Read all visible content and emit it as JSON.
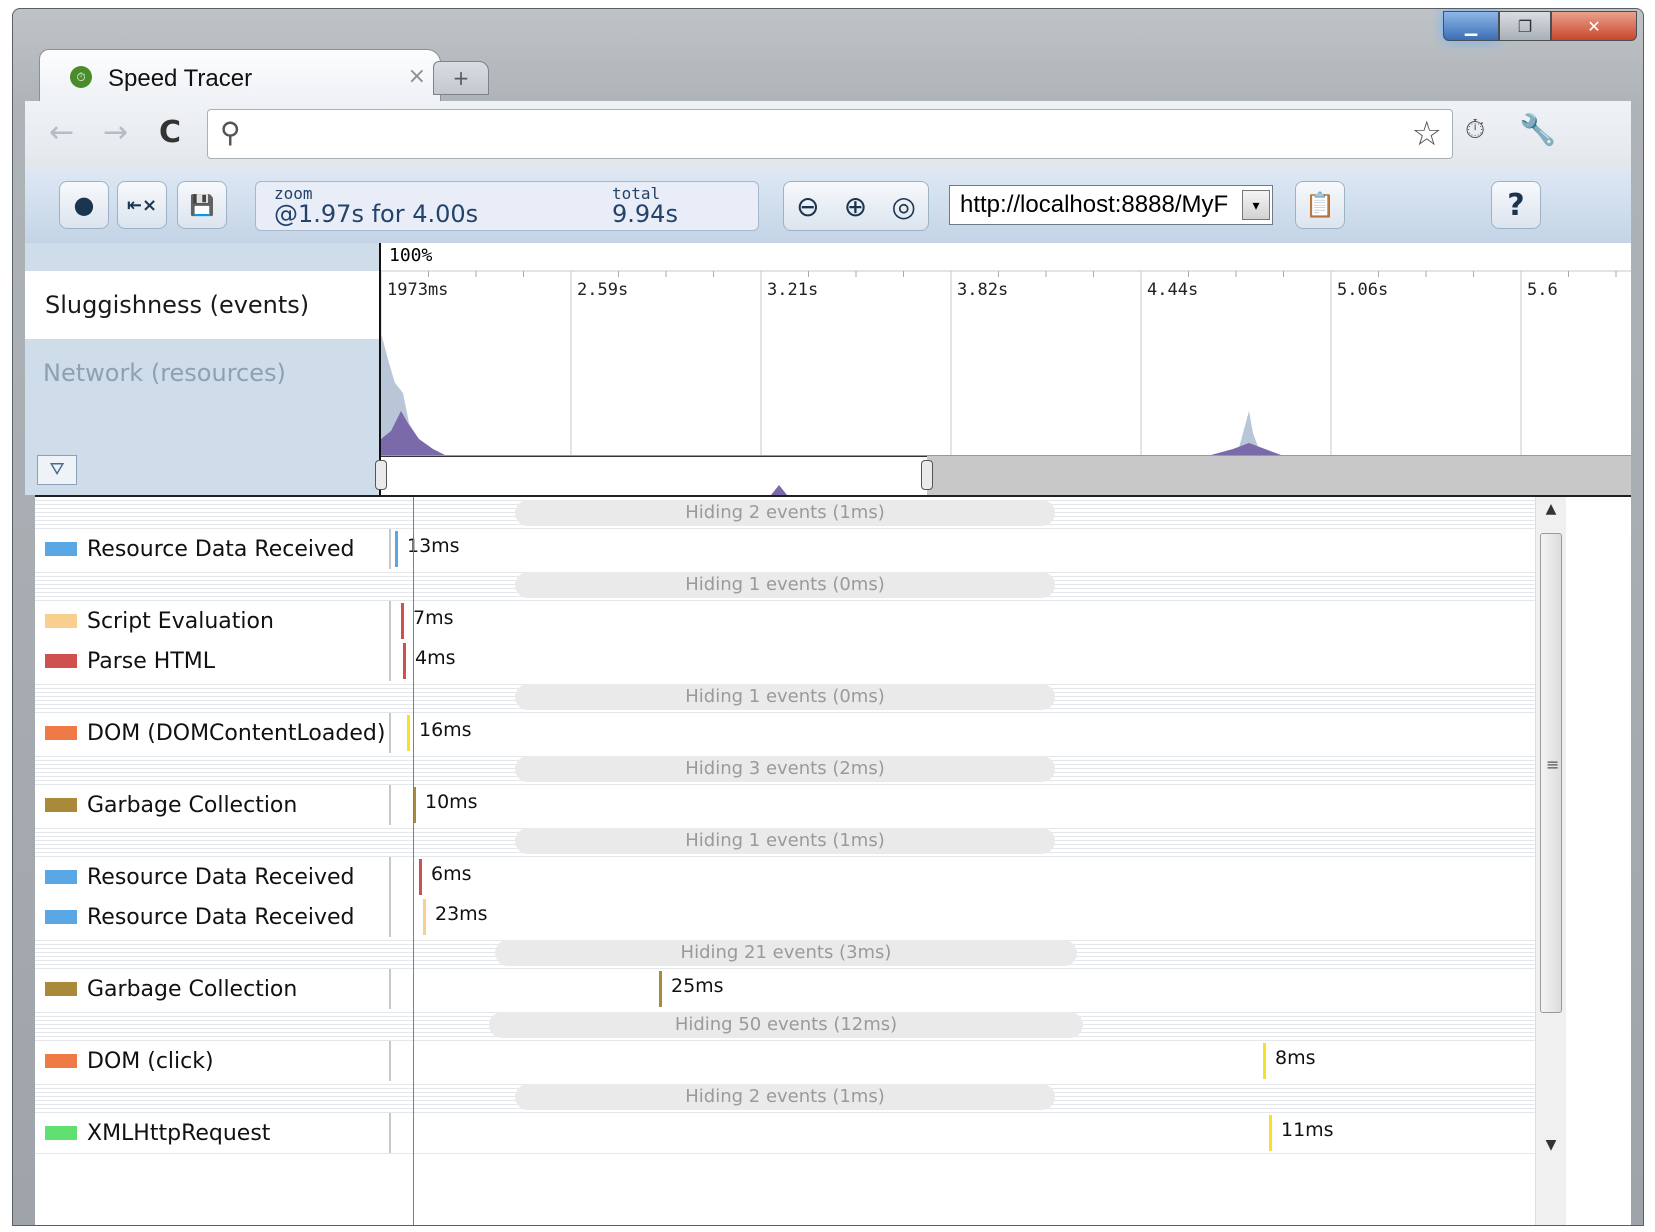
{
  "window": {
    "tab_title": "Speed Tracer",
    "tab_close": "×",
    "new_tab": "+",
    "min": "▁",
    "max": "❐",
    "close": "✕"
  },
  "toolbar": {
    "back_icon": "←",
    "forward_icon": "→",
    "reload_icon": "C",
    "search_icon": "⚲",
    "address_value": "",
    "star_icon": "☆",
    "extension_icon": "⏱",
    "wrench_icon": "🔧"
  },
  "speedtracer": {
    "record_icon": "●",
    "clear_icon": "⇤×",
    "save_icon": "💾",
    "zoom_label": "zoom",
    "zoom_value": "@1.97s for 4.00s",
    "total_label": "total",
    "total_value": "9.94s",
    "zoom_out_icon": "⊖",
    "zoom_in_icon": "⊕",
    "zoom_fit_icon": "◎",
    "url_selected": "http://localhost:8888/MyF",
    "dropdown_icon": "▾",
    "report_icon": "📋",
    "help_label": "?"
  },
  "overview": {
    "tracks": [
      {
        "label": "Sluggishness (events)"
      },
      {
        "label": "Network (resources)"
      }
    ],
    "filter_icon": "⛛",
    "percent_label": "100%",
    "ticks": [
      "1973ms",
      "2.59s",
      "3.21s",
      "3.82s",
      "4.44s",
      "5.06s",
      "5.6"
    ],
    "colors": {
      "graph_fill": "#7a6aaa",
      "graph_light": "#b9c6d8"
    }
  },
  "events": [
    {
      "kind": "hiding",
      "text": "Hiding 2 events (1ms)"
    },
    {
      "kind": "row",
      "label": "Resource Data Received",
      "swatch": "#5aa7e6",
      "mark": "#5aa7e6",
      "dur": "13ms"
    },
    {
      "kind": "hiding",
      "text": "Hiding 1 events (0ms)"
    },
    {
      "kind": "row",
      "label": "Script Evaluation",
      "swatch": "#f9cf90",
      "mark": "#d05050",
      "dur": "7ms"
    },
    {
      "kind": "row",
      "label": "Parse HTML",
      "swatch": "#d05050",
      "mark": "#d05050",
      "dur": "4ms"
    },
    {
      "kind": "hiding",
      "text": "Hiding 1 events (0ms)"
    },
    {
      "kind": "row",
      "label": "DOM (DOMContentLoaded)",
      "swatch": "#f07a46",
      "mark": "#f5e12a",
      "dur": "16ms"
    },
    {
      "kind": "hiding",
      "text": "Hiding 3 events (2ms)"
    },
    {
      "kind": "row",
      "label": "Garbage Collection",
      "swatch": "#a88a3a",
      "mark": "#a88a3a",
      "dur": "10ms"
    },
    {
      "kind": "hiding",
      "text": "Hiding 1 events (1ms)"
    },
    {
      "kind": "row",
      "label": "Resource Data Received",
      "swatch": "#5aa7e6",
      "mark": "#d05050",
      "dur": "6ms"
    },
    {
      "kind": "row",
      "label": "Resource Data Received",
      "swatch": "#5aa7e6",
      "mark": "#f9cf90",
      "dur": "23ms"
    },
    {
      "kind": "hiding",
      "text": "Hiding 21 events (3ms)"
    },
    {
      "kind": "row",
      "label": "Garbage Collection",
      "swatch": "#a88a3a",
      "mark": "#a88a3a",
      "dur": "25ms"
    },
    {
      "kind": "hiding",
      "text": "Hiding 50 events (12ms)"
    },
    {
      "kind": "row",
      "label": "DOM (click)",
      "swatch": "#f07a46",
      "mark": "#f5e12a",
      "dur": "8ms"
    },
    {
      "kind": "hiding",
      "text": "Hiding 2 events (1ms)"
    },
    {
      "kind": "row",
      "label": "XMLHttpRequest",
      "swatch": "#5fe070",
      "mark": "#f5e12a",
      "dur": "11ms"
    }
  ]
}
